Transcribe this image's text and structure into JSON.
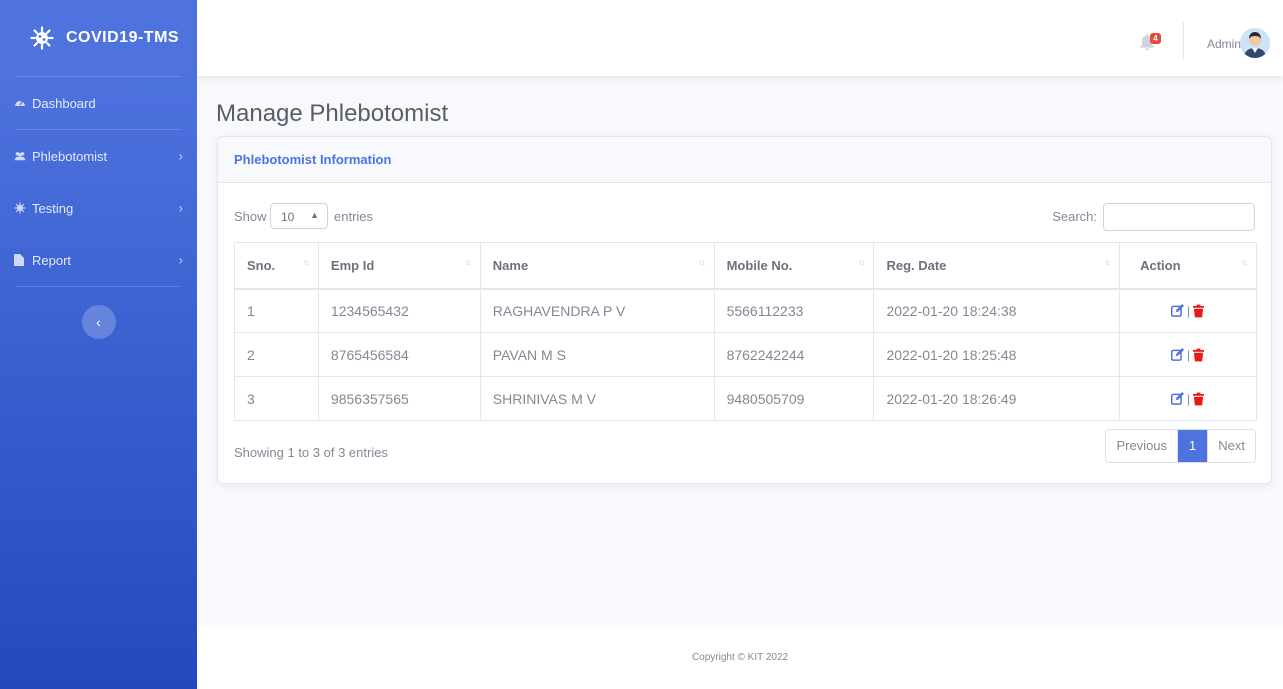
{
  "brand": {
    "title": "COVID19-TMS"
  },
  "sidebar": {
    "items": [
      {
        "label": "Dashboard",
        "icon": "tachometer-icon",
        "has_submenu": false
      },
      {
        "label": "Phlebotomist",
        "icon": "users-icon",
        "has_submenu": true
      },
      {
        "label": "Testing",
        "icon": "virus-icon",
        "has_submenu": true
      },
      {
        "label": "Report",
        "icon": "file-icon",
        "has_submenu": true
      }
    ],
    "toggle_icon": "chevron-left-icon"
  },
  "topbar": {
    "alert_count": "4",
    "user_name": "Admin"
  },
  "page": {
    "title": "Manage Phlebotomist"
  },
  "card": {
    "title": "Phlebotomist Information"
  },
  "table_controls": {
    "show_label": "Show",
    "page_length": "10",
    "entries_label": "entries",
    "search_label": "Search:",
    "search_value": ""
  },
  "table": {
    "columns": [
      "Sno.",
      "Emp Id",
      "Name",
      "Mobile No.",
      "Reg. Date",
      "Action"
    ],
    "rows": [
      {
        "sno": "1",
        "emp_id": "1234565432",
        "name": "RAGHAVENDRA P V",
        "mobile": "5566112233",
        "reg_date": "2022-01-20 18:24:38"
      },
      {
        "sno": "2",
        "emp_id": "8765456584",
        "name": "PAVAN M S",
        "mobile": "8762242244",
        "reg_date": "2022-01-20 18:25:48"
      },
      {
        "sno": "3",
        "emp_id": "9856357565",
        "name": "SHRINIVAS M V",
        "mobile": "9480505709",
        "reg_date": "2022-01-20 18:26:49"
      }
    ],
    "action_separator": "|"
  },
  "pagination": {
    "info": "Showing 1 to 3 of 3 entries",
    "previous": "Previous",
    "current": "1",
    "next": "Next"
  },
  "footer": {
    "text": "Copyright © KIT 2022"
  },
  "colors": {
    "primary": "#4e73df",
    "danger": "#e74a3b",
    "sidebar_bottom": "#224abe"
  }
}
